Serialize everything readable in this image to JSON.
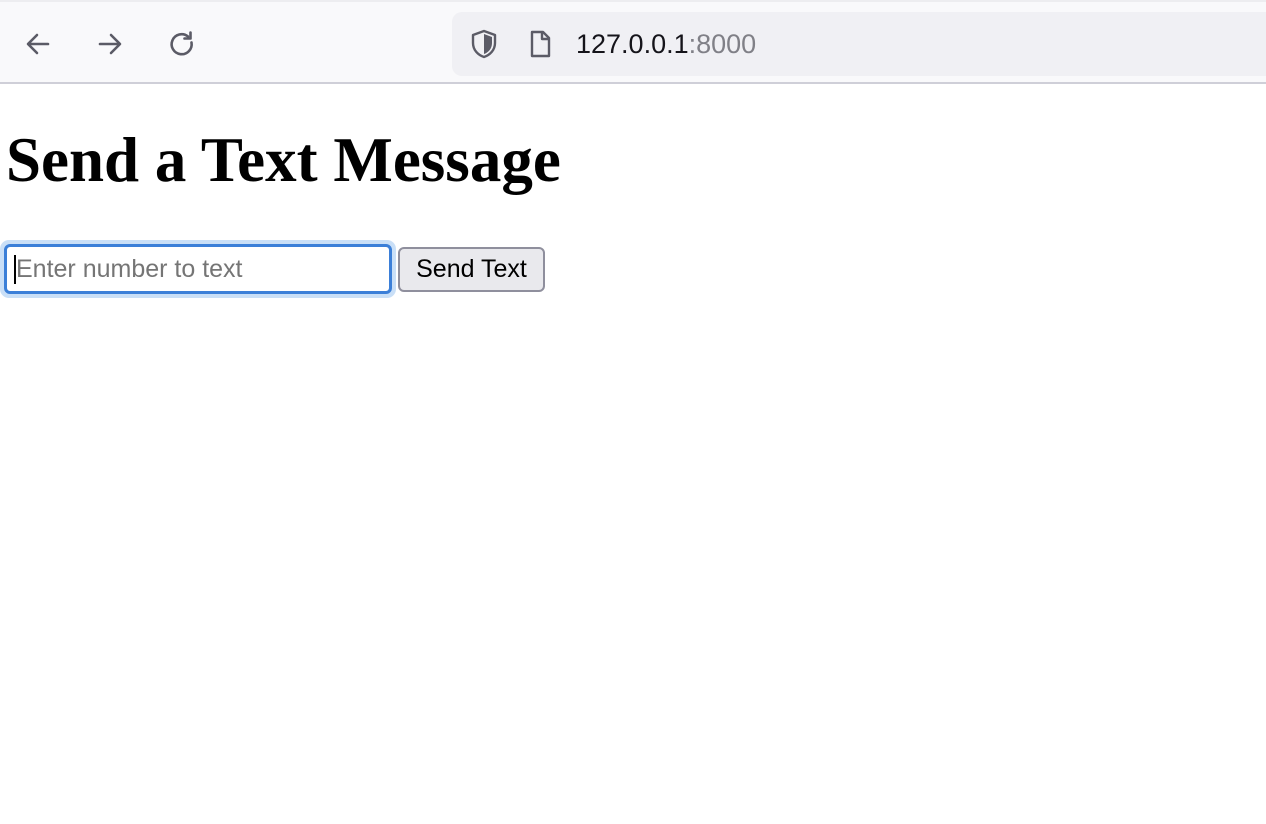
{
  "browser": {
    "url_host": "127.0.0.1",
    "url_port": ":8000",
    "icons": {
      "back": "arrow-left-icon",
      "forward": "arrow-right-icon",
      "reload": "reload-icon",
      "security": "shield-icon",
      "page": "page-icon"
    }
  },
  "page": {
    "title": "Send a Text Message",
    "input": {
      "value": "",
      "placeholder": "Enter number to text",
      "focused": true
    },
    "send_button_label": "Send Text"
  },
  "colors": {
    "focus_accent": "#3b7fd8",
    "button_background": "#e9e9ed"
  }
}
